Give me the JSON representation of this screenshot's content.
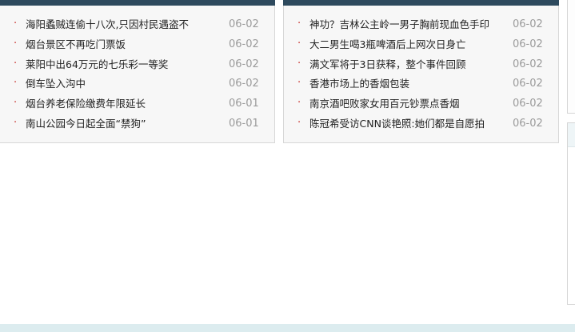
{
  "left_panel": {
    "items": [
      {
        "title": "海阳蟊贼连偷十八次,只因村民遇盗不",
        "date": "06-02"
      },
      {
        "title": "烟台景区不再吃门票饭",
        "date": "06-02"
      },
      {
        "title": "莱阳中出64万元的七乐彩一等奖",
        "date": "06-02"
      },
      {
        "title": "倒车坠入沟中",
        "date": "06-02"
      },
      {
        "title": "烟台养老保险缴费年限延长",
        "date": "06-01"
      },
      {
        "title": "南山公园今日起全面“禁狗”",
        "date": "06-01"
      }
    ]
  },
  "right_panel": {
    "items": [
      {
        "title": "神功？吉林公主岭一男子胸前现血色手印",
        "date": "06-02"
      },
      {
        "title": "大二男生喝3瓶啤酒后上网次日身亡",
        "date": "06-02"
      },
      {
        "title": "满文军将于3日获释，整个事件回顾",
        "date": "06-02"
      },
      {
        "title": "香港市场上的香烟包装",
        "date": "06-02"
      },
      {
        "title": "南京酒吧败家女用百元钞票点香烟",
        "date": "06-02"
      },
      {
        "title": "陈冠希受访CNN谈艳照:她们都是自愿拍",
        "date": "06-02"
      }
    ]
  },
  "colors": {
    "header_bar": "#2e4a5e",
    "bullet": "#c8322d",
    "panel_bg": "#f7f7f7",
    "date_text": "#9a9a9a",
    "footer_band": "#dcecef"
  }
}
